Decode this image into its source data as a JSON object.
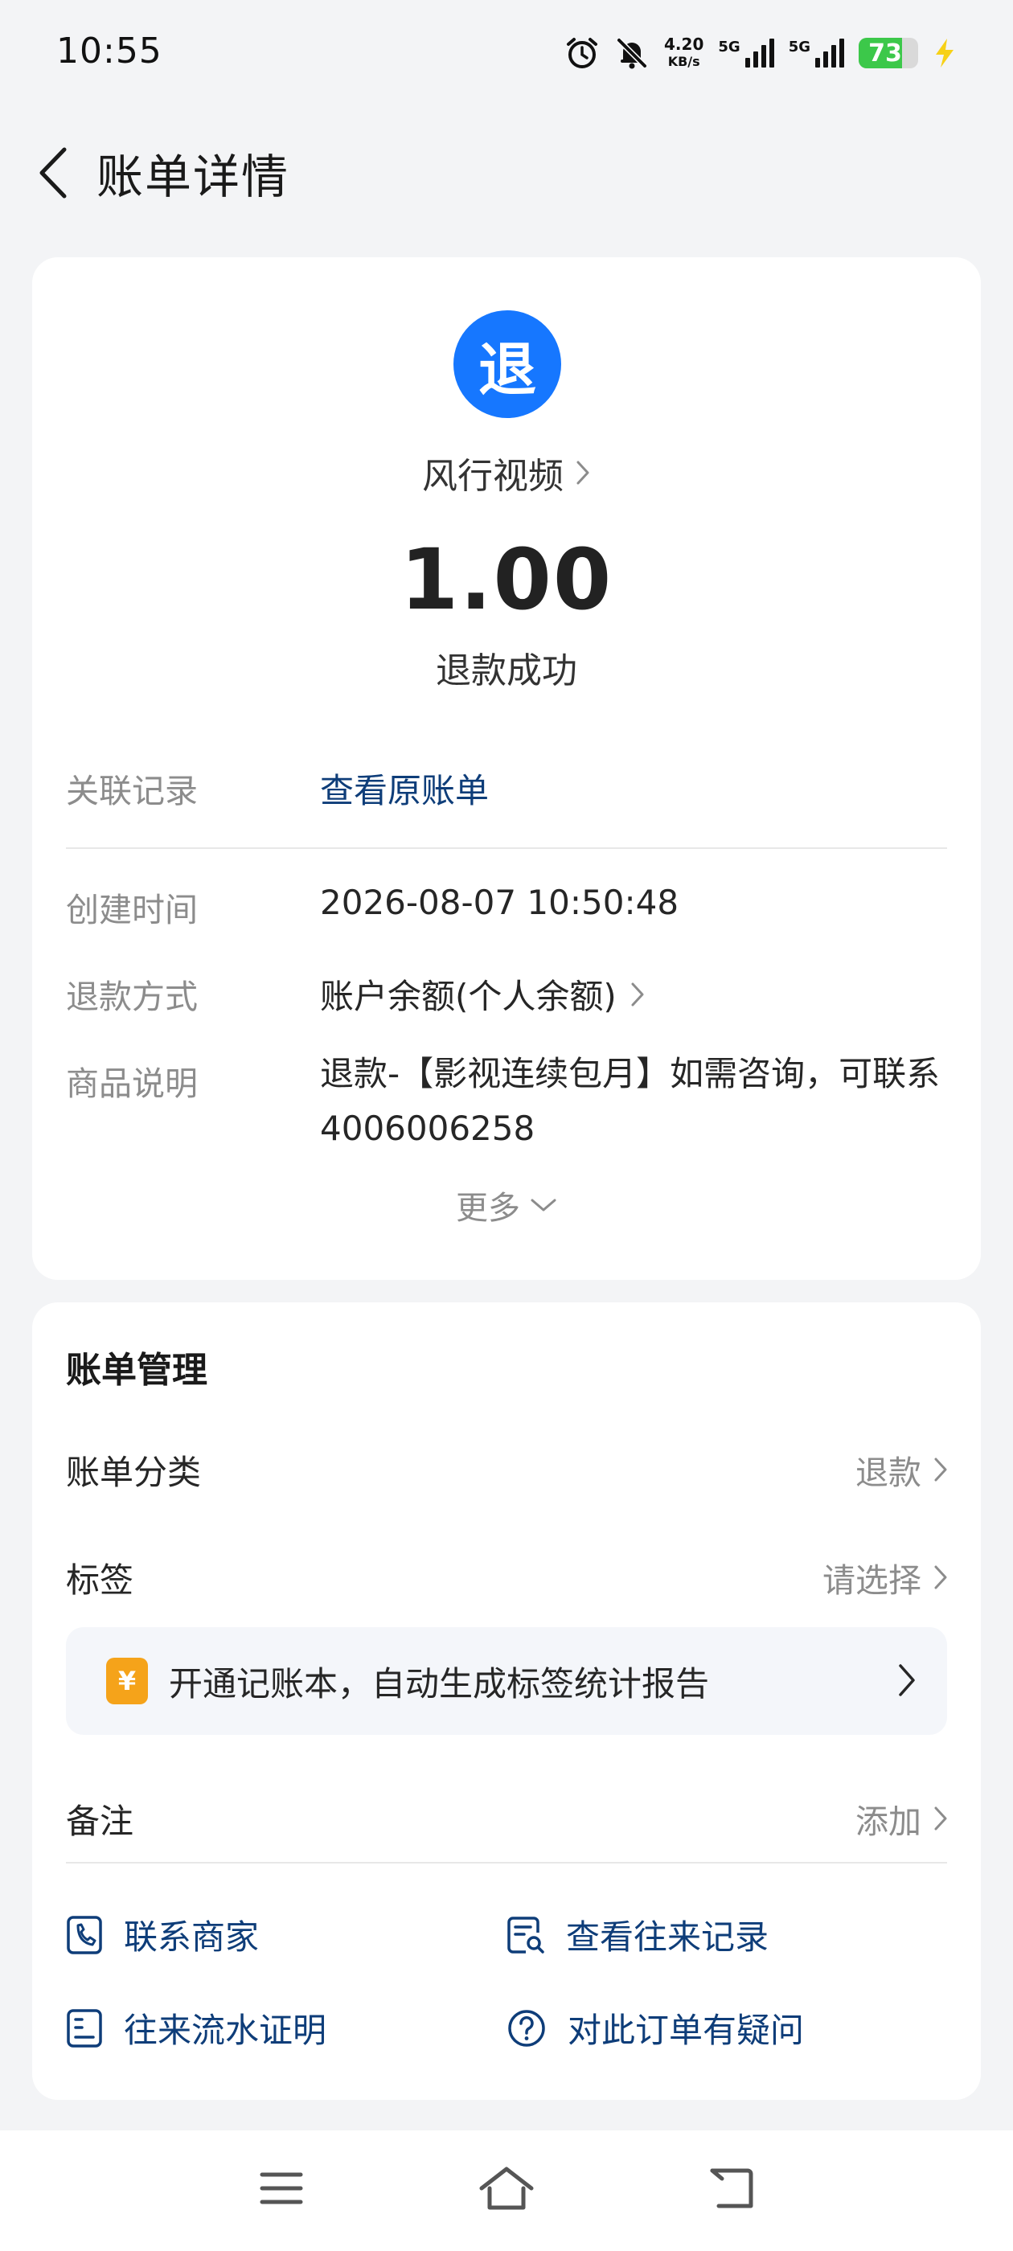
{
  "status_bar": {
    "time": "10:55",
    "speed_value": "4.20",
    "speed_unit": "KB/s",
    "sim1_label": "5G",
    "sim2_label": "5G",
    "battery": "73",
    "battery_level": 0.73,
    "icons": [
      "alarm-icon",
      "mute-icon",
      "signal-icon",
      "signal-icon",
      "battery-icon",
      "charging-icon"
    ]
  },
  "header": {
    "title": "账单详情"
  },
  "transaction": {
    "logo_char": "退",
    "merchant": "风行视频",
    "amount": "1.00",
    "status": "退款成功"
  },
  "details": {
    "related_label": "关联记录",
    "related_value": "查看原账单",
    "created_label": "创建时间",
    "created_value": "2026-08-07 10:50:48",
    "method_label": "退款方式",
    "method_value": "账户余额(个人余额)",
    "desc_label": "商品说明",
    "desc_value": "退款-【影视连续包月】如需咨询，可联系4006006258",
    "more_label": "更多"
  },
  "management": {
    "title": "账单管理",
    "category_label": "账单分类",
    "category_value": "退款",
    "tag_label": "标签",
    "tag_value": "请选择",
    "promo_icon_char": "¥",
    "promo_text": "开通记账本，自动生成标签统计报告",
    "note_label": "备注",
    "note_value": "添加"
  },
  "actions": {
    "contact_merchant": "联系商家",
    "view_history": "查看往来记录",
    "statement_proof": "往来流水证明",
    "order_question": "对此订单有疑问"
  },
  "colors": {
    "accent_blue": "#1677ff",
    "link_blue": "#0e3d79",
    "promo_orange": "#f5a31a",
    "battery_green": "#3cc84a"
  }
}
